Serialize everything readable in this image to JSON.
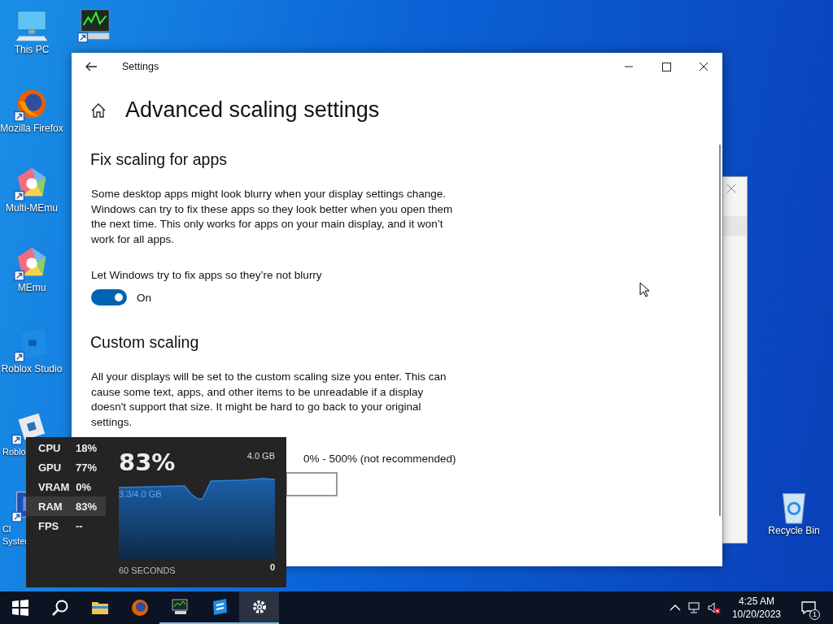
{
  "desktop_icons": [
    {
      "kind": "computer",
      "label": "This PC",
      "shortcut": false
    },
    {
      "kind": "monitor-graph",
      "shortcut": true
    },
    {
      "kind": "firefox",
      "label": "Mozilla Firefox",
      "shortcut": true
    },
    {
      "kind": "multi-memu",
      "label": "Multi-MEmu",
      "shortcut": true
    },
    {
      "kind": "memu",
      "label": "MEmu",
      "shortcut": true
    },
    {
      "kind": "roblox-studio",
      "label": "Roblox Studio",
      "shortcut": true
    },
    {
      "kind": "roblox",
      "label": "Roblo",
      "shortcut": true
    },
    {
      "kind": "system",
      "label": "Cl",
      "label_2": "Syster",
      "shortcut": true
    },
    {
      "kind": "recycle-bin",
      "label": "Recycle Bin",
      "shortcut": false
    }
  ],
  "settings_window": {
    "title": "Settings",
    "heading": "Advanced scaling settings",
    "sections": [
      {
        "title": "Fix scaling for apps",
        "text": "Some desktop apps might look blurry when your display settings change. Windows can try to fix these apps so they look better when you open them the next time. This only works for apps on your main display, and it won’t work for all apps.",
        "toggle": {
          "label": "Let Windows try to fix apps so they’re not blurry",
          "on": true,
          "state_text": "On"
        }
      },
      {
        "title": "Custom scaling",
        "text": "All your displays will be set to the custom scaling size you enter. This can cause some text, apps, and other items to be unreadable if a display doesn't support that size. It might be hard to go back to your original settings.",
        "range_text": "0% - 500% (not recommended)"
      }
    ]
  },
  "performance_overlay": {
    "metrics": [
      {
        "label": "CPU",
        "value": "18%",
        "selected": false
      },
      {
        "label": "GPU",
        "value": "77%",
        "selected": false
      },
      {
        "label": "VRAM",
        "value": "0%",
        "selected": false
      },
      {
        "label": "RAM",
        "value": "83%",
        "selected": true
      },
      {
        "label": "FPS",
        "value": "--",
        "selected": false
      }
    ],
    "big_value": "83%",
    "max_label": "4.0 GB",
    "usage_label": "3.3/4.0 GB",
    "time_label": "60 SECONDS",
    "min_label": "0"
  },
  "taskbar": {
    "items": [
      {
        "kind": "start",
        "running": false,
        "selected": false
      },
      {
        "kind": "search",
        "running": false,
        "selected": false
      },
      {
        "kind": "folder",
        "running": false,
        "selected": false
      },
      {
        "kind": "firefox",
        "running": false,
        "selected": false
      },
      {
        "kind": "monitor-graph",
        "running": true,
        "selected": false
      },
      {
        "kind": "roblox-studio",
        "running": true,
        "selected": false
      },
      {
        "kind": "settings",
        "running": true,
        "selected": true
      }
    ],
    "time": "4:25 AM",
    "date": "10/20/2023",
    "notifications": "1"
  }
}
